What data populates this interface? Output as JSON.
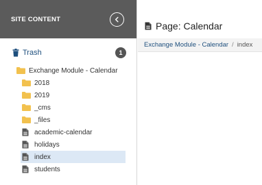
{
  "sidebar": {
    "title": "SITE CONTENT",
    "trash": {
      "label": "Trash",
      "count": "1"
    },
    "tree": {
      "root": "Exchange Module - Calendar",
      "children": [
        "2018",
        "2019",
        "_cms",
        "_files",
        "academic-calendar",
        "holidays",
        "index",
        "students"
      ]
    }
  },
  "main": {
    "title": "Page: Calendar",
    "breadcrumb": {
      "parent": "Exchange Module - Calendar",
      "separator": "/",
      "current": "index"
    }
  },
  "colors": {
    "header_bg": "#5b5b5b",
    "link": "#1e4f7d",
    "folder": "#f2c14e",
    "selected_bg": "#dce8f5"
  },
  "icons": {
    "collapse": "chevron-left-icon",
    "trash": "trash-icon",
    "folder": "folder-icon",
    "file": "file-icon"
  }
}
